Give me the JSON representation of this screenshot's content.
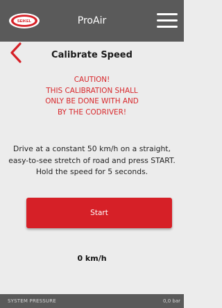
{
  "header": {
    "logo_text": "SEIKEL",
    "title": "ProAir",
    "menu_icon": "hamburger-icon"
  },
  "page": {
    "back_icon": "chevron-left-icon",
    "title": "Calibrate Speed",
    "caution_lines": [
      "CAUTION!",
      "THIS CALIBRATION SHALL",
      "ONLY BE DONE WITH AND",
      "BY THE CODRIVER!"
    ],
    "instruction_lines": [
      "Drive at a constant 50 km/h on a straight,",
      "easy-to-see stretch of road and press START.",
      "Hold the speed for 5 seconds."
    ],
    "start_label": "Start",
    "speed_readout": "0 km/h"
  },
  "footer": {
    "label": "SYSTEM PRESSURE",
    "value": "0,0 bar"
  },
  "colors": {
    "header_bg": "#5a5a5a",
    "page_bg": "#ececec",
    "accent_red": "#d62027",
    "caution_red": "#d8262a"
  }
}
